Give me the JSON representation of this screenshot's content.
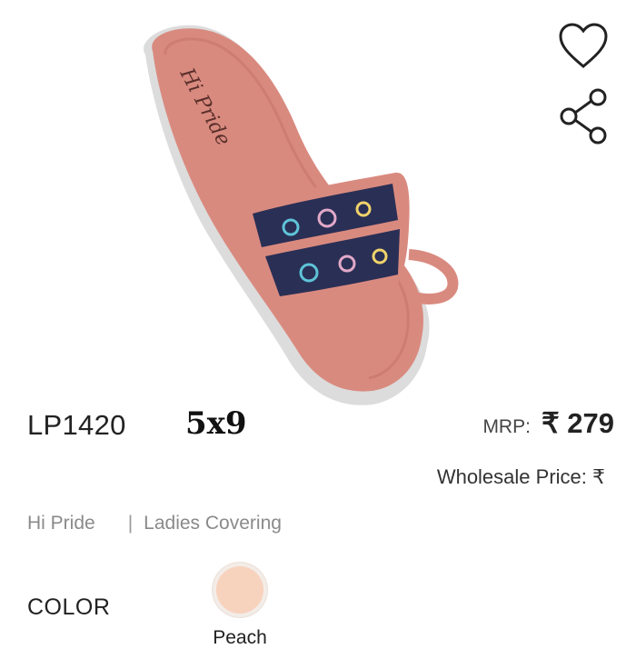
{
  "product": {
    "code": "LP1420",
    "size": "5x9",
    "mrp_label": "MRP:",
    "mrp_value": "₹ 279",
    "wholesale_label": "Wholesale Price: ₹",
    "brand": "Hi Pride",
    "separator": "|",
    "category": "Ladies Covering",
    "sole_text": "Hi Pride",
    "sole_caption": "Ladies Covering"
  },
  "color": {
    "heading": "COLOR",
    "options": [
      {
        "name": "Peach",
        "hex": "#f7d2bd",
        "selected": true
      }
    ]
  },
  "actions": {
    "wishlist_icon": "heart-icon",
    "share_icon": "share-icon"
  },
  "colors": {
    "sandal_body": "#d98a7f",
    "sandal_sole": "#dcdcdc",
    "pattern_dark": "#2a2f55"
  }
}
